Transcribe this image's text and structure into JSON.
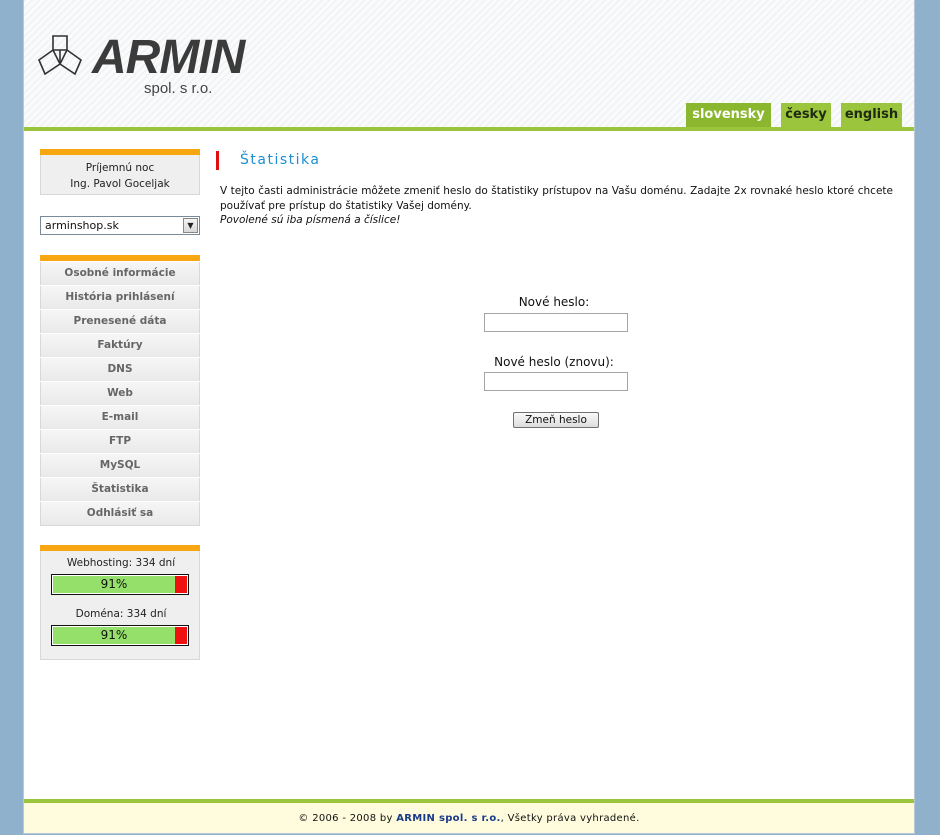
{
  "header": {
    "logo_text": "ARMIN",
    "logo_subtext": "spol. s r.o."
  },
  "languages": [
    {
      "label": "slovensky",
      "active": true
    },
    {
      "label": "česky",
      "active": false
    },
    {
      "label": "english",
      "active": false
    }
  ],
  "sidebar": {
    "greeting_line1": "Príjemnú noc",
    "greeting_line2": "Ing. Pavol Goceljak",
    "domain_select_value": "arminshop.sk",
    "menu": [
      "Osobné informácie",
      "História prihlásení",
      "Prenesené dáta",
      "Faktúry",
      "DNS",
      "Web",
      "E-mail",
      "FTP",
      "MySQL",
      "Štatistika",
      "Odhlásiť sa"
    ],
    "status": {
      "webhosting_label": "Webhosting: 334 dní",
      "webhosting_percent_text": "91%",
      "webhosting_percent": 91,
      "domain_label": "Doména: 334 dní",
      "domain_percent_text": "91%",
      "domain_percent": 91
    }
  },
  "content": {
    "title": "Štatistika",
    "description": "V tejto časti administrácie môžete zmeniť heslo do štatistiky prístupov na Vašu doménu. Zadajte 2x rovnaké heslo ktoré chcete používať pre prístup do štatistiky Vašej domény.",
    "note": "Povolené sú iba písmená a číslice!",
    "new_password_label": "Nové heslo:",
    "new_password_value": "",
    "repeat_password_label": "Nové heslo (znovu):",
    "repeat_password_value": "",
    "submit_label": "Zmeň heslo"
  },
  "footer": {
    "prefix": "© 2006 - 2008 by ",
    "brand": "ARMIN spol. s r.o.",
    "suffix": ", Všetky práva vyhradené."
  },
  "colors": {
    "accent_green": "#9bc53d",
    "accent_orange": "#f8a713",
    "title_blue": "#1e8ed0",
    "marker_red": "#e01010"
  }
}
